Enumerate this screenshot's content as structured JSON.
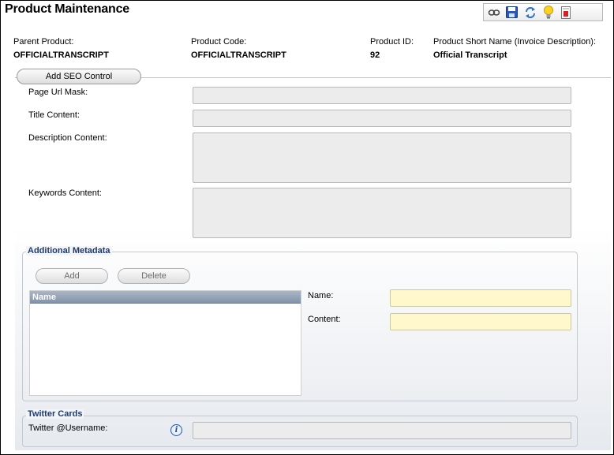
{
  "page": {
    "title": "Product Maintenance"
  },
  "toolbar": {
    "buttons": [
      {
        "icon": "view-icon"
      },
      {
        "icon": "save-icon"
      },
      {
        "icon": "refresh-icon"
      },
      {
        "icon": "lightbulb-icon"
      },
      {
        "icon": "report-icon"
      }
    ]
  },
  "header": {
    "parent_product_label": "Parent Product:",
    "parent_product_value": "OFFICIALTRANSCRIPT",
    "product_code_label": "Product Code:",
    "product_code_value": "OFFICIALTRANSCRIPT",
    "product_id_label": "Product ID:",
    "product_id_value": "92",
    "short_name_label": "Product Short Name (Invoice Description):",
    "short_name_value": "Official Transcript"
  },
  "seo": {
    "add_button_label": "Add SEO Control",
    "page_url_mask_label": "Page Url Mask:",
    "page_url_mask_value": "",
    "title_content_label": "Title Content:",
    "title_content_value": "",
    "description_content_label": "Description Content:",
    "description_content_value": "",
    "keywords_content_label": "Keywords Content:",
    "keywords_content_value": ""
  },
  "metadata": {
    "legend": "Additional Metadata",
    "add_label": "Add",
    "delete_label": "Delete",
    "grid_column": "Name",
    "name_label": "Name:",
    "name_value": "",
    "content_label": "Content:",
    "content_value": ""
  },
  "twitter": {
    "legend": "Twitter Cards",
    "username_label": "Twitter @Username:",
    "username_value": ""
  },
  "colors": {
    "legend_text": "#1f3a6e",
    "required_field": "#fff8cc",
    "grid_header": "#8393a8"
  }
}
